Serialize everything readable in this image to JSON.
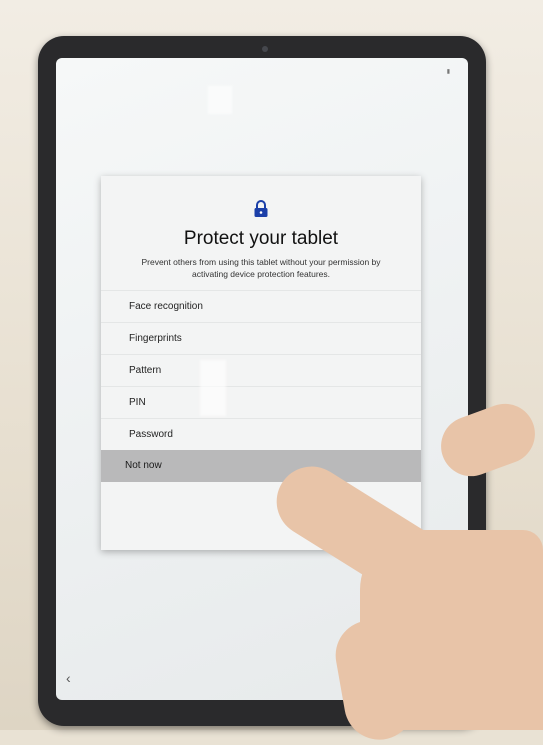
{
  "setup": {
    "title": "Protect your tablet",
    "description": "Prevent others from using this tablet without your permission by activating device protection features.",
    "options": [
      {
        "label": "Face recognition"
      },
      {
        "label": "Fingerprints"
      },
      {
        "label": "Pattern"
      },
      {
        "label": "PIN"
      },
      {
        "label": "Password"
      },
      {
        "label": "Not now",
        "selected": true
      }
    ]
  },
  "nav": {
    "back_glyph": "‹"
  },
  "colors": {
    "lock_icon": "#1b3fa8",
    "selected_row": "#b9b9ba"
  },
  "icons": [
    "lock-icon",
    "back-icon"
  ]
}
